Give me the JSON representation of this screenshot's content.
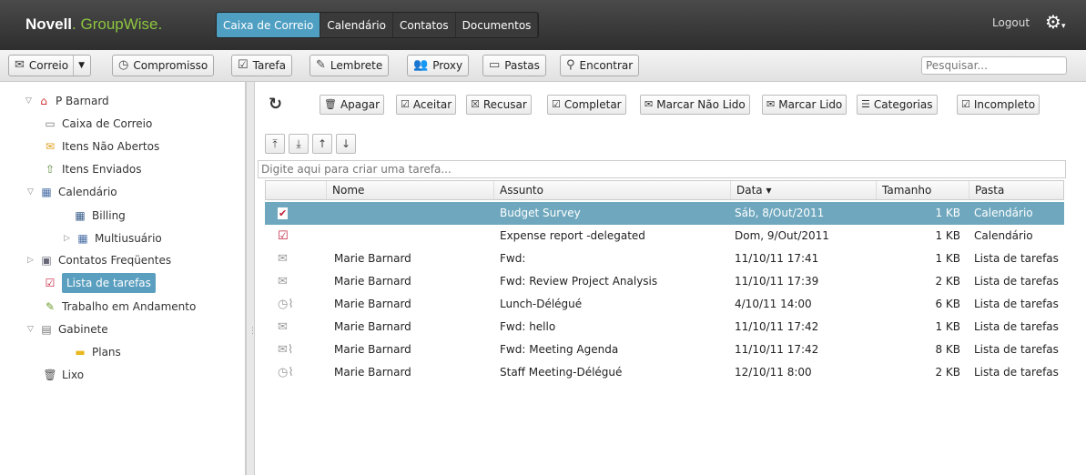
{
  "app": {
    "brand_main": "Novell",
    "brand_sub": ". GroupWise."
  },
  "main_tabs": [
    {
      "label": "Caixa de Correio",
      "active": true
    },
    {
      "label": "Calendário",
      "active": false
    },
    {
      "label": "Contatos",
      "active": false
    },
    {
      "label": "Documentos",
      "active": false
    }
  ],
  "header": {
    "logout": "Logout",
    "gear_icon": "gear-icon"
  },
  "toolbar": {
    "correio": "Correio",
    "compromisso": "Compromisso",
    "tarefa": "Tarefa",
    "lembrete": "Lembrete",
    "proxy": "Proxy",
    "pastas": "Pastas",
    "encontrar": "Encontrar",
    "search_placeholder": "Pesquisar..."
  },
  "sidebar": {
    "root": "P Barnard",
    "items": [
      {
        "label": "Caixa de Correio",
        "icon": "mailbox-icon"
      },
      {
        "label": "Itens Não Abertos",
        "icon": "unopened-envelope-icon"
      },
      {
        "label": "Itens Enviados",
        "icon": "sent-items-icon"
      },
      {
        "label": "Calendário",
        "icon": "calendar-icon"
      },
      {
        "label": "Billing",
        "icon": "shared-calendar-icon"
      },
      {
        "label": "Multiusuário",
        "icon": "calendar-icon"
      },
      {
        "label": "Contatos Freqüentes",
        "icon": "contacts-icon"
      },
      {
        "label": "Lista de tarefas",
        "icon": "checklist-icon",
        "selected": true
      },
      {
        "label": "Trabalho em Andamento",
        "icon": "work-in-progress-icon"
      },
      {
        "label": "Gabinete",
        "icon": "cabinet-icon"
      },
      {
        "label": "Plans",
        "icon": "folder-icon"
      },
      {
        "label": "Lixo",
        "icon": "trash-icon"
      }
    ]
  },
  "actions": {
    "apagar": "Apagar",
    "aceitar": "Aceitar",
    "recusar": "Recusar",
    "completar": "Completar",
    "marcar_nao_lido": "Marcar Não Lido",
    "marcar_lido": "Marcar Lido",
    "categorias": "Categorias",
    "incompleto": "Incompleto"
  },
  "new_task_placeholder": "Digite aqui para criar uma tarefa...",
  "table": {
    "columns": [
      "Nome",
      "Assunto",
      "Data ▾",
      "Tamanho",
      "Pasta"
    ],
    "rows": [
      {
        "icon": "task-checked-icon",
        "nome": "",
        "assunto": "Budget Survey",
        "data": "Sáb, 8/Out/2011",
        "tamanho": "1 KB",
        "pasta": "Calendário",
        "selected": true
      },
      {
        "icon": "task-checked-icon",
        "nome": "",
        "assunto": "Expense report -delegated",
        "data": "Dom, 9/Out/2011",
        "tamanho": "1 KB",
        "pasta": "Calendário"
      },
      {
        "icon": "opened-envelope-icon",
        "nome": "Marie Barnard",
        "assunto": "Fwd:",
        "data": "11/10/11 17:41",
        "tamanho": "1 KB",
        "pasta": "Lista de tarefas"
      },
      {
        "icon": "opened-envelope-icon",
        "nome": "Marie Barnard",
        "assunto": "Fwd: Review Project Analysis",
        "data": "11/10/11 17:39",
        "tamanho": "2 KB",
        "pasta": "Lista de tarefas"
      },
      {
        "icon": "clock-attachment-icon",
        "nome": "Marie Barnard",
        "assunto": "Lunch-Délégué",
        "data": "4/10/11 14:00",
        "tamanho": "6 KB",
        "pasta": "Lista de tarefas"
      },
      {
        "icon": "opened-envelope-icon",
        "nome": "Marie Barnard",
        "assunto": "Fwd: hello",
        "data": "11/10/11 17:42",
        "tamanho": "1 KB",
        "pasta": "Lista de tarefas"
      },
      {
        "icon": "envelope-attachment-icon",
        "nome": "Marie Barnard",
        "assunto": "Fwd: Meeting Agenda",
        "data": "11/10/11 17:42",
        "tamanho": "8 KB",
        "pasta": "Lista de tarefas"
      },
      {
        "icon": "clock-attachment-icon",
        "nome": "Marie Barnard",
        "assunto": "Staff Meeting-Délégué",
        "data": "12/10/11 8:00",
        "tamanho": "2 KB",
        "pasta": "Lista de tarefas"
      }
    ]
  },
  "colors": {
    "accent": "#4f9fc3",
    "selected_row": "#6fa8be",
    "topbar": "#3a3a3a",
    "brand_green": "#8dc63f"
  }
}
